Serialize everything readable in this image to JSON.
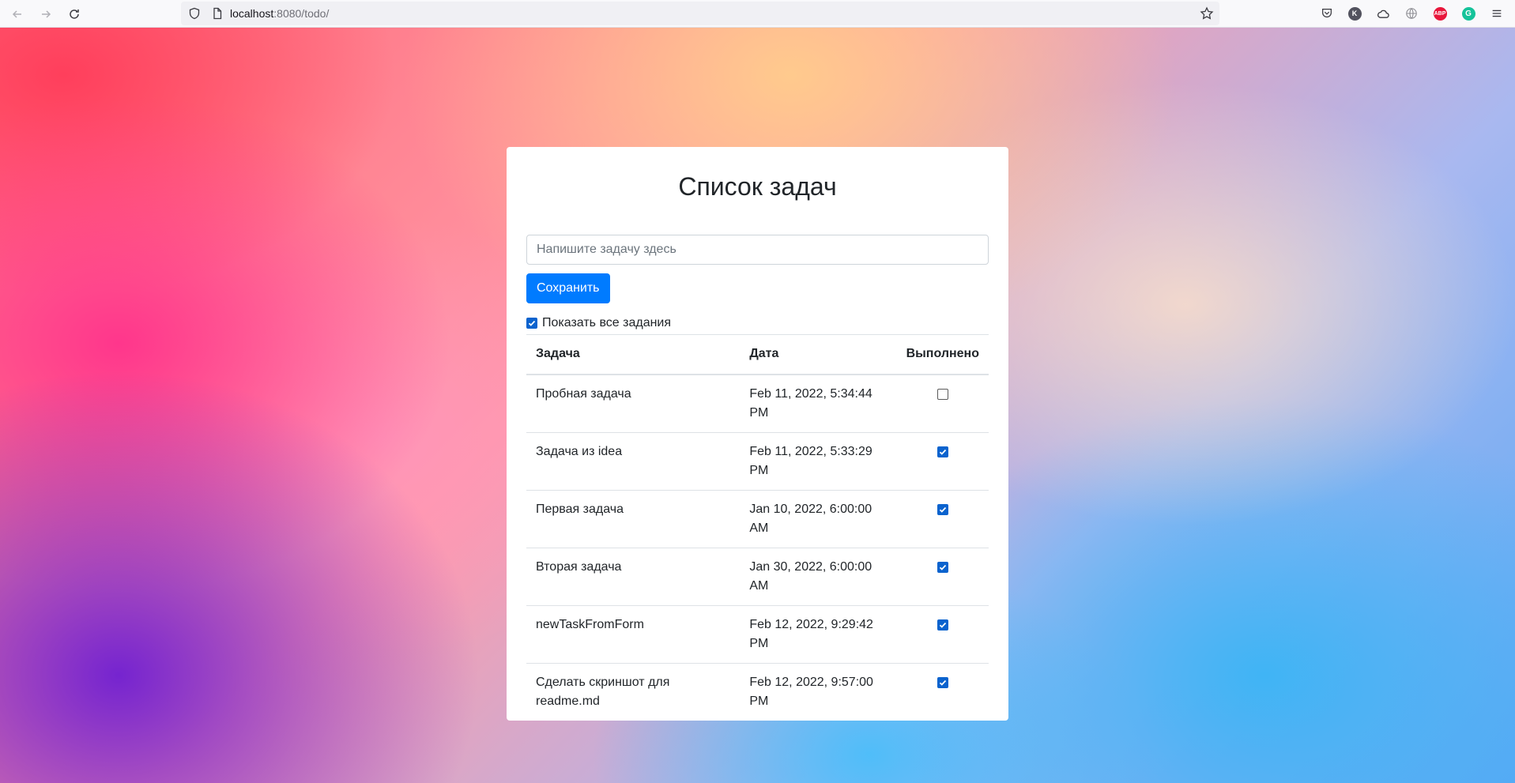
{
  "browser": {
    "url_host": "localhost",
    "url_rest": ":8080/todo/"
  },
  "page": {
    "title": "Список задач",
    "input_placeholder": "Напишите задачу здесь",
    "save_label": "Сохранить",
    "show_all_label": "Показать все задания",
    "show_all_checked": true
  },
  "table": {
    "headers": [
      "Задача",
      "Дата",
      "Выполнено"
    ],
    "rows": [
      {
        "task": "Пробная задача",
        "date": "Feb 11, 2022, 5:34:44 PM",
        "done": false
      },
      {
        "task": "Задача из idea",
        "date": "Feb 11, 2022, 5:33:29 PM",
        "done": true
      },
      {
        "task": "Первая задача",
        "date": "Jan 10, 2022, 6:00:00 AM",
        "done": true
      },
      {
        "task": "Вторая задача",
        "date": "Jan 30, 2022, 6:00:00 AM",
        "done": true
      },
      {
        "task": "newTaskFromForm",
        "date": "Feb 12, 2022, 9:29:42 PM",
        "done": true
      },
      {
        "task": "Сделать скриншот для readme.md",
        "date": "Feb 12, 2022, 9:57:00 PM",
        "done": true
      }
    ]
  },
  "colors": {
    "primary": "#007bff",
    "checkbox_checked": "#0b63ce"
  }
}
